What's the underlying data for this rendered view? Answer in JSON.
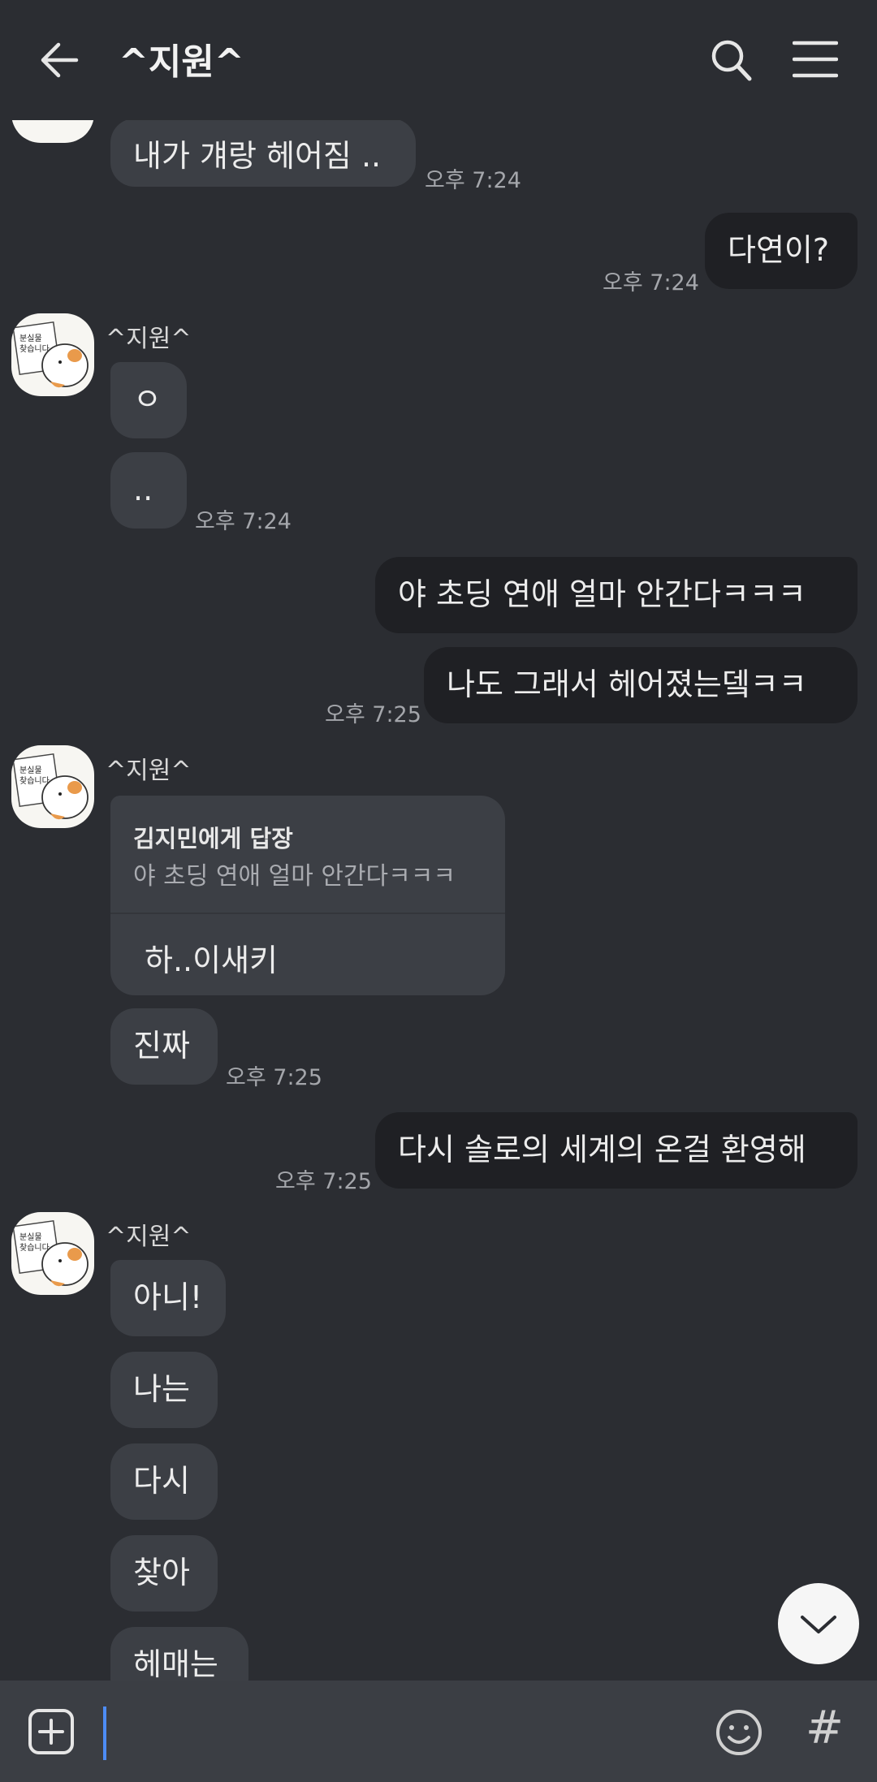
{
  "header": {
    "title": "^지원^"
  },
  "contact": {
    "name": "^지원^"
  },
  "messages": [
    {
      "side": "in",
      "text": "내가 걔랑 헤어짐 ..",
      "time": "오후 7:24"
    },
    {
      "side": "out",
      "text": "다연이?",
      "time": "오후 7:24"
    },
    {
      "side": "in",
      "sender": "^지원^",
      "text": "ㅇ"
    },
    {
      "side": "in",
      "text": "..",
      "time": "오후 7:24"
    },
    {
      "side": "out",
      "text": "야 초딩 연애 얼마 안간다ㅋㅋㅋ"
    },
    {
      "side": "out",
      "text": "나도 그래서 헤어졌는뎈ㅋㅋ",
      "time": "오후 7:25"
    },
    {
      "side": "in",
      "sender": "^지원^",
      "reply_to": "김지민에게 답장",
      "reply_quote": "야 초딩 연애 얼마 안간다ㅋㅋㅋ",
      "text": "하..이새키"
    },
    {
      "side": "in",
      "text": "진짜",
      "time": "오후 7:25"
    },
    {
      "side": "out",
      "text": "다시 솔로의 세계의 온걸 환영해",
      "time": "오후 7:25"
    },
    {
      "side": "in",
      "sender": "^지원^",
      "text": "아니!"
    },
    {
      "side": "in",
      "text": "나는"
    },
    {
      "side": "in",
      "text": "다시"
    },
    {
      "side": "in",
      "text": "찾아"
    },
    {
      "side": "in",
      "text": "헤매는"
    }
  ],
  "avatar": {
    "sign_text": [
      "분실물",
      "찾습니다"
    ]
  },
  "icons": {
    "back": "arrow-left-icon",
    "search": "search-icon",
    "menu": "hamburger-menu-icon",
    "scroll": "chevron-down-icon",
    "plus": "plus-square-icon",
    "emoji": "smiley-icon",
    "hash": "#"
  },
  "colors": {
    "background": "#2b2d32",
    "incoming_bubble": "#3c3f45",
    "outgoing_bubble": "#1f2024",
    "cursor": "#4d8cf5"
  }
}
